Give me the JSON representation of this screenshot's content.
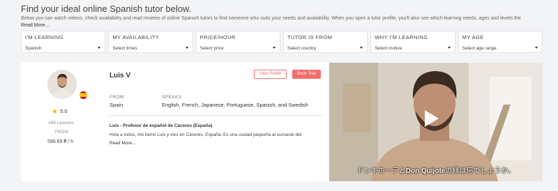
{
  "page": {
    "headline": "Find your ideal online Spanish tutor below.",
    "intro": "Below you can watch videos, check availability and read reviews of online Spanish tutors to find someone who suits your needs and availability. When you open a tutor profile, you'll also see which learning needs, ages and levels the",
    "read_more": "Read More..."
  },
  "filters": [
    {
      "label": "I'M LEARNING",
      "value": "Spanish"
    },
    {
      "label": "MY AVAILABILITY",
      "value": "Select times"
    },
    {
      "label": "PRICE/HOUR",
      "value": "Select price"
    },
    {
      "label": "TUTOR IS FROM",
      "value": "Select country"
    },
    {
      "label": "WHY I'M LEARNING",
      "value": "Select motive"
    },
    {
      "label": "MY AGE",
      "value": "Select age range"
    }
  ],
  "tutor": {
    "name": "Luis V",
    "rating": "5.0",
    "lessons": "165 Lessons",
    "from_price_label": "FROM",
    "price": "599.69 ₴ / h",
    "view_profile": "View Profile",
    "book_trial": "Book Trial",
    "from_label": "FROM",
    "from_value": "Spain",
    "speaks_label": "SPEAKS",
    "speaks_value": "English, French, Japanese, Portuguese, Spanish, and Swedish",
    "headline": "Luis - Profesor de español de Cáceres (España)",
    "bio": "Hola a todos, me llamo Luis y vivo en Cáceres, España. Es una ciudad pequeña al suroeste del",
    "read_more": "Read More..."
  },
  "video": {
    "subtitle_before": "ドンキホーテと",
    "subtitle_bold": "Don Quijote",
    "subtitle_after": "の絆は何でしょうか。"
  },
  "colors": {
    "accent": "#f26d6d",
    "star": "#f5b301"
  }
}
